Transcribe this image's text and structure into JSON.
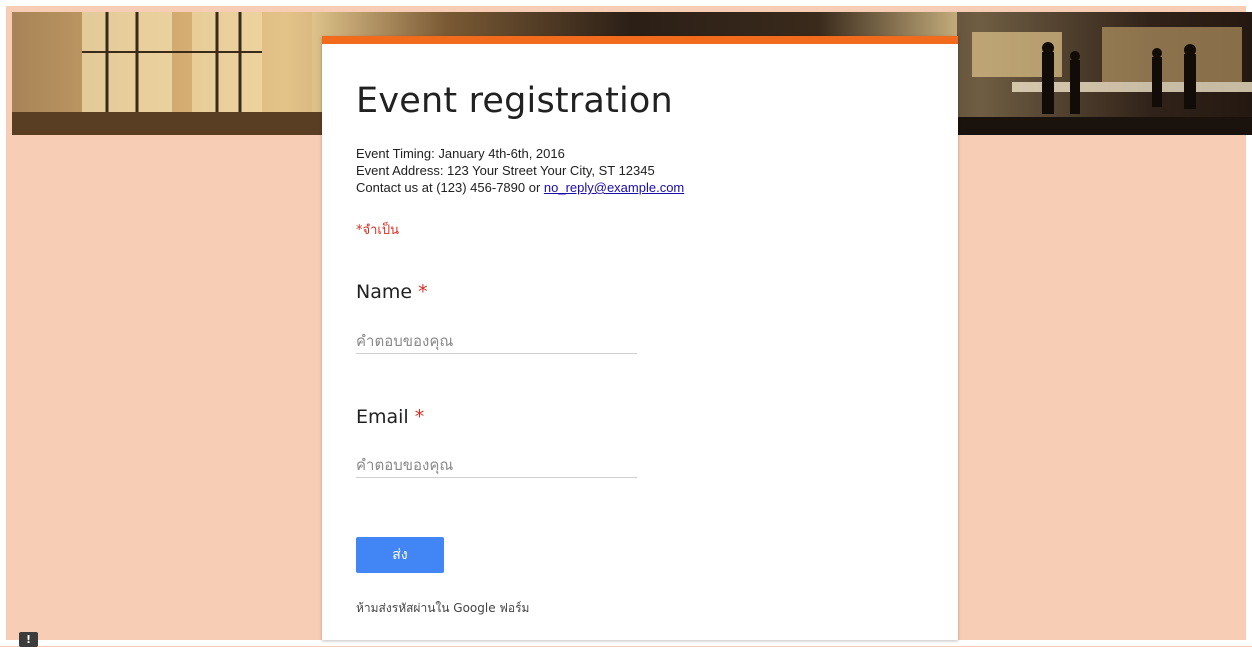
{
  "form": {
    "title": "Event registration",
    "description": {
      "timing": "Event Timing: January 4th-6th, 2016",
      "address": "Event Address: 123 Your Street Your City, ST 12345",
      "contact_prefix": "Contact us at (123) 456-7890 or ",
      "contact_email": "no_reply@example.com"
    },
    "required_note": "*จำเป็น",
    "questions": [
      {
        "label": "Name",
        "required_mark": "*",
        "placeholder": "คำตอบของคุณ",
        "value": ""
      },
      {
        "label": "Email",
        "required_mark": "*",
        "placeholder": "คำตอบของคุณ",
        "value": ""
      }
    ],
    "submit_label": "ส่ง",
    "footer_note": "ห้ามส่งรหัสผ่านใน Google ฟอร์ม"
  },
  "feedback": {
    "icon": "exclamation-icon",
    "glyph": "!"
  },
  "colors": {
    "background": "#f7cdb6",
    "accent": "#f26b1d",
    "required": "#d93025",
    "button": "#4285f4"
  }
}
